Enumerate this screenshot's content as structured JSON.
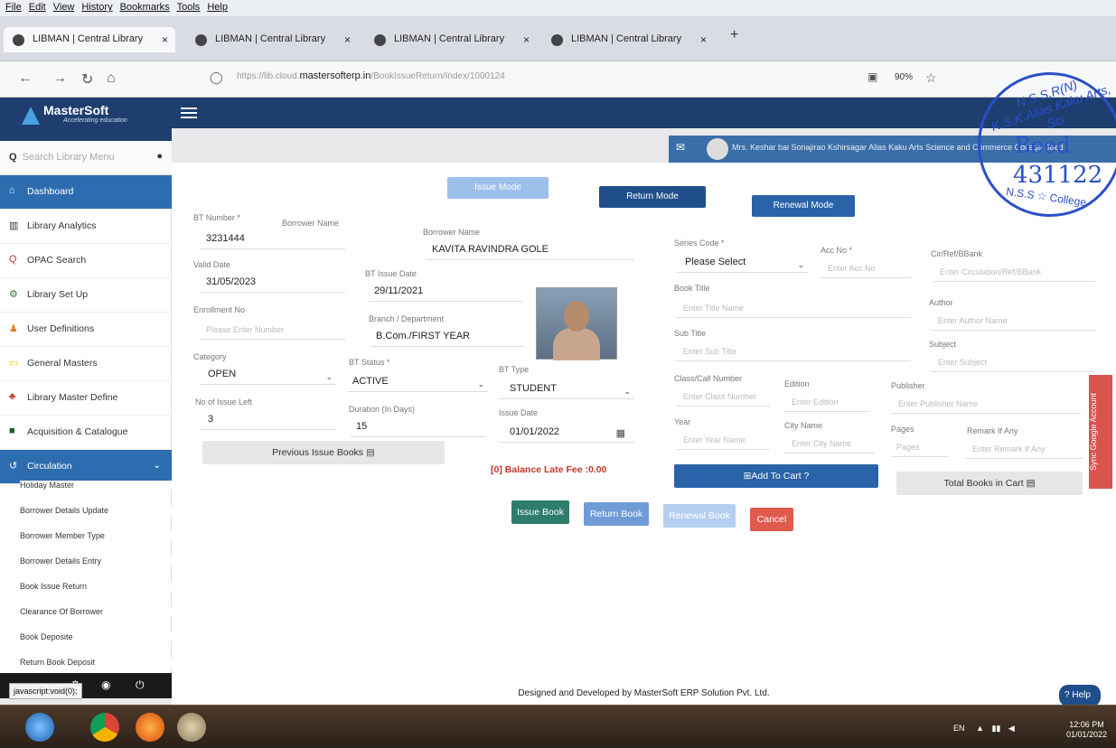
{
  "browser": {
    "menu": [
      "File",
      "Edit",
      "View",
      "History",
      "Bookmarks",
      "Tools",
      "Help"
    ],
    "tabs": [
      "LIBMAN | Central Library",
      "LIBMAN | Central Library",
      "LIBMAN | Central Library",
      "LIBMAN | Central Library"
    ],
    "url_prefix": "https://lib.cloud.",
    "url_domain": "mastersofterp.in",
    "url_path": "/BookIssueReturn/Index/1000124",
    "zoom": "90%",
    "status_link": "javascript:void(0);"
  },
  "brand": {
    "name": "MasterSoft",
    "tagline": "Accelerating education"
  },
  "sidebar": {
    "search_placeholder": "Search Library Menu",
    "items": [
      {
        "label": "Dashboard",
        "icon": "home-icon"
      },
      {
        "label": "Library Analytics",
        "icon": "bar-chart-icon"
      },
      {
        "label": "OPAC Search",
        "icon": "search-icon"
      },
      {
        "label": "Library Set Up",
        "icon": "cogs-icon"
      },
      {
        "label": "User Definitions",
        "icon": "users-icon"
      },
      {
        "label": "General Masters",
        "icon": "folder-icon"
      },
      {
        "label": "Library Master Define",
        "icon": "books-icon"
      },
      {
        "label": "Acquisition & Catalogue",
        "icon": "book-icon"
      },
      {
        "label": "Circulation",
        "icon": "circulation-icon"
      }
    ],
    "subitems": [
      "Holiday Master",
      "Borrower Details Update",
      "Borrower Member Type",
      "Borrower Details Entry",
      "Book Issue Return",
      "Clearance Of Borrower",
      "Book Deposite",
      "Return Book Deposit"
    ]
  },
  "header": {
    "user": "Mrs. Keshar bai Sonajirao Kshirsagar Alias Kaku Arts Science and Commerce College Beed"
  },
  "modes": {
    "issue": "Issue Mode",
    "return": "Return Mode",
    "renewal": "Renewal Mode"
  },
  "borrower": {
    "bt_number_label": "BT Number *",
    "bt_number": "3231444",
    "borrower_name_label_small": "Borrower Name",
    "borrower_name_label": "Borrower Name",
    "borrower_name": "KAVITA RAVINDRA GOLE",
    "valid_date_label": "Valid Date",
    "valid_date": "31/05/2023",
    "bt_issue_date_label": "BT Issue Date",
    "bt_issue_date": "29/11/2021",
    "enrollment_label": "Enrollment No",
    "enrollment_placeholder": "Please Enter Number",
    "branch_label": "Branch / Department",
    "branch": "B.Com./FIRST YEAR",
    "category_label": "Category",
    "category": "OPEN",
    "bt_status_label": "BT Status *",
    "bt_status": "ACTIVE",
    "bt_type_label": "BT Type",
    "bt_type": "STUDENT",
    "issue_left_label": "No of Issue Left",
    "issue_left": "3",
    "duration_label": "Duration (In Days)",
    "duration": "15",
    "issue_date_label": "Issue Date",
    "issue_date": "01/01/2022",
    "prev_issue_btn": "Previous Issue Books",
    "late_fee": "[0] Balance Late Fee :0.00"
  },
  "book": {
    "series_label": "Series Code *",
    "series_value": "Please Select",
    "acc_label": "Acc No *",
    "acc_placeholder": "Enter Acc No",
    "cir_label": "Cir/Ref/BBank",
    "cir_placeholder": "Enter Circulation/Ref/BBank",
    "title_label": "Book Title",
    "title_placeholder": "Enter Title Name",
    "author_label": "Author",
    "author_placeholder": "Enter Author Name",
    "subtitle_label": "Sub Title",
    "subtitle_placeholder": "Enter Sub Title",
    "subject_label": "Subject",
    "subject_placeholder": "Enter Subject",
    "class_label": "Class/Call Number",
    "class_placeholder": "Enter Class Number",
    "edition_label": "Edition",
    "edition_placeholder": "Enter Edition",
    "publisher_label": "Publisher",
    "publisher_placeholder": "Enter Publisher Name",
    "year_label": "Year",
    "year_placeholder": "Enter Year Name",
    "city_label": "City Name",
    "city_placeholder": "Enter City Name",
    "pages_label": "Pages",
    "pages_placeholder": "Pages",
    "remark_label": "Remark If Any",
    "remark_placeholder": "Enter Remark If Any",
    "add_cart": "Add To Cart ?",
    "total_cart": "Total Books in Cart"
  },
  "actions": {
    "issue": "Issue Book",
    "return": "Return Book",
    "renew": "Renewal Book",
    "cancel": "Cancel"
  },
  "footer": {
    "text": "Designed and Developed by MasterSoft ERP Solution Pvt. Ltd.",
    "help": "Help",
    "sync": "Sync Google Account"
  },
  "stamp": {
    "ring": "N.S.S.R(N) K.S.K.Alias Kaku Arts, Sci",
    "line1": "Beed",
    "line2": "431122",
    "bottom": "N.S.S ☆ College"
  },
  "taskbar": {
    "lang": "EN",
    "time": "12:06 PM",
    "date": "01/01/2022"
  },
  "colors": {
    "navy": "#1d3e6e",
    "active": "#2e6cb0",
    "issue_btn": "#2e7d6b",
    "return_btn": "#6f9bd6",
    "cancel": "#e05a4e"
  }
}
